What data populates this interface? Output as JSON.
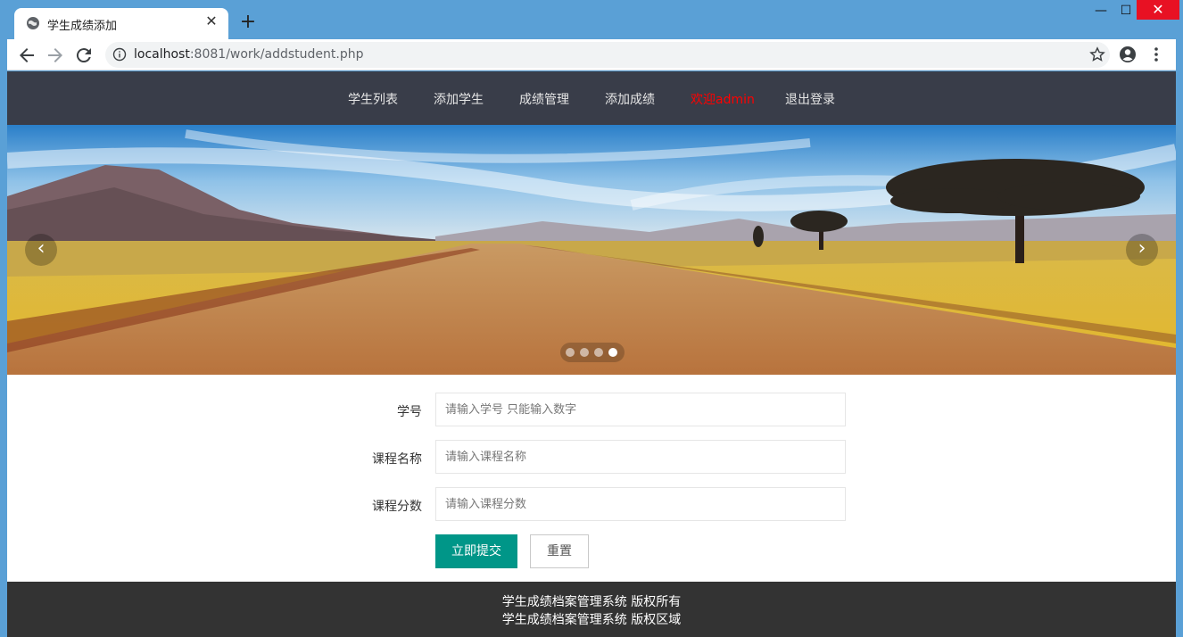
{
  "browser": {
    "tab_title": "学生成绩添加",
    "url_host": "localhost",
    "url_rest": ":8081/work/addstudent.php"
  },
  "nav": {
    "items": [
      "学生列表",
      "添加学生",
      "成绩管理",
      "添加成绩",
      "欢迎admin",
      "退出登录"
    ]
  },
  "carousel": {
    "prev_label": "‹",
    "next_label": "›",
    "slide_count": 4,
    "active_index": 3
  },
  "form": {
    "student_id": {
      "label": "学号",
      "placeholder": "请输入学号 只能输入数字",
      "value": ""
    },
    "course_name": {
      "label": "课程名称",
      "placeholder": "请输入课程名称",
      "value": ""
    },
    "course_score": {
      "label": "课程分数",
      "placeholder": "请输入课程分数",
      "value": ""
    },
    "submit_label": "立即提交",
    "reset_label": "重置"
  },
  "footer": {
    "line1": "学生成绩档案管理系统 版权所有",
    "line2": "学生成绩档案管理系统 版权区域"
  },
  "colors": {
    "nav_bg": "#393d49",
    "welcome": "#ff0000",
    "submit_bg": "#009688",
    "footer_bg": "#333333"
  }
}
